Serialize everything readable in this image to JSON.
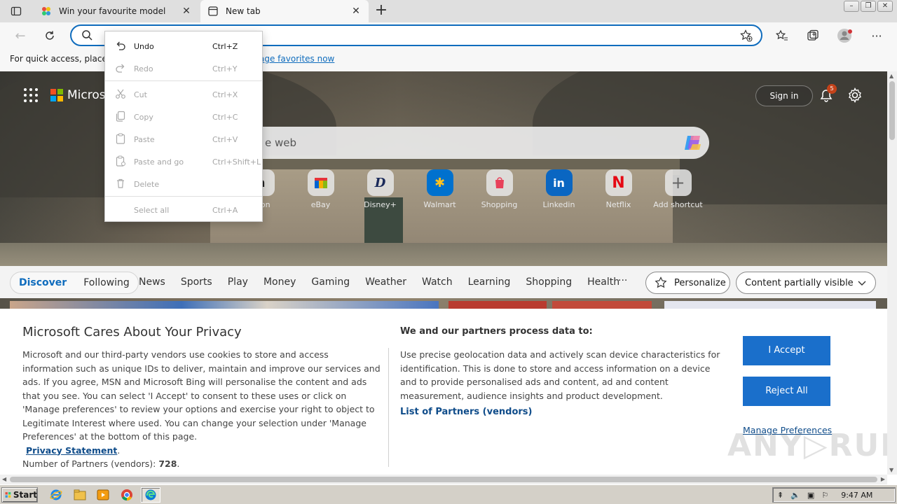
{
  "browser": {
    "tabs": [
      {
        "title": "Win your favourite model",
        "active": false
      },
      {
        "title": "New tab",
        "active": true
      }
    ],
    "address_value": "",
    "favorites_bar": {
      "text": "For quick access, place yo",
      "link": "age favorites now"
    }
  },
  "context_menu": {
    "items": [
      {
        "label": "Undo",
        "shortcut": "Ctrl+Z",
        "enabled": true,
        "icon": "undo-icon"
      },
      {
        "label": "Redo",
        "shortcut": "Ctrl+Y",
        "enabled": false,
        "icon": "redo-icon"
      },
      {
        "label": "Cut",
        "shortcut": "Ctrl+X",
        "enabled": false,
        "icon": "cut-icon"
      },
      {
        "label": "Copy",
        "shortcut": "Ctrl+C",
        "enabled": false,
        "icon": "copy-icon"
      },
      {
        "label": "Paste",
        "shortcut": "Ctrl+V",
        "enabled": false,
        "icon": "paste-icon"
      },
      {
        "label": "Paste and go",
        "shortcut": "Ctrl+Shift+L",
        "enabled": false,
        "icon": "paste-go-icon"
      },
      {
        "label": "Delete",
        "shortcut": "",
        "enabled": false,
        "icon": "delete-icon"
      },
      {
        "label": "Select all",
        "shortcut": "Ctrl+A",
        "enabled": false,
        "icon": ""
      }
    ]
  },
  "newtab": {
    "brand": "Microso",
    "sign_in": "Sign in",
    "notification_count": "5",
    "search_placeholder": "e web",
    "shortcuts": [
      {
        "label": "azon",
        "glyph": "a",
        "color": "#222222"
      },
      {
        "label": "eBay",
        "glyph": "▦",
        "color": "#e53238"
      },
      {
        "label": "Disney+",
        "glyph": "D",
        "color": "#1b2a5a"
      },
      {
        "label": "Walmart",
        "glyph": "✱",
        "color": "#0071ce"
      },
      {
        "label": "Shopping",
        "glyph": "◆",
        "color": "#e8415a"
      },
      {
        "label": "Linkedin",
        "glyph": "in",
        "color": "#0a66c2"
      },
      {
        "label": "Netflix",
        "glyph": "N",
        "color": "#e50914"
      },
      {
        "label": "Add shortcut",
        "glyph": "+",
        "color": "#666666"
      }
    ],
    "feed": {
      "pill_tabs": [
        "Discover",
        "Following"
      ],
      "tabs": [
        "News",
        "Sports",
        "Play",
        "Money",
        "Gaming",
        "Weather",
        "Watch",
        "Learning",
        "Shopping",
        "Health"
      ],
      "more": "···",
      "personalize": "Personalize",
      "visibility": "Content partially visible"
    }
  },
  "privacy": {
    "title": "Microsoft Cares About Your Privacy",
    "body": "Microsoft and our third-party vendors use cookies to store and access information such as unique IDs to deliver, maintain and improve our services and ads. If you agree, MSN and Microsoft Bing will personalise the content and ads that you see. You can select 'I Accept' to consent to these uses or click on 'Manage preferences' to review your options and exercise your right to object to Legitimate Interest where used.  You can change your selection under 'Manage Preferences' at the bottom of this page.",
    "privacy_link": "Privacy Statement",
    "partners_prefix": "Number of Partners (vendors): ",
    "partners_count": "728",
    "right_title": "We and our partners process data to:",
    "right_body": "Use precise geolocation data and actively scan device characteristics for identification. This is done to store and access information on a device and to provide personalised ads and content, ad and content measurement, audience insights and product development.",
    "partners_link": "List of Partners (vendors)",
    "accept": "I Accept",
    "reject": "Reject All",
    "manage": "Manage Preferences",
    "watermark": "ANY▷RUN"
  },
  "taskbar": {
    "start": "Start",
    "clock": "9:47 AM"
  }
}
